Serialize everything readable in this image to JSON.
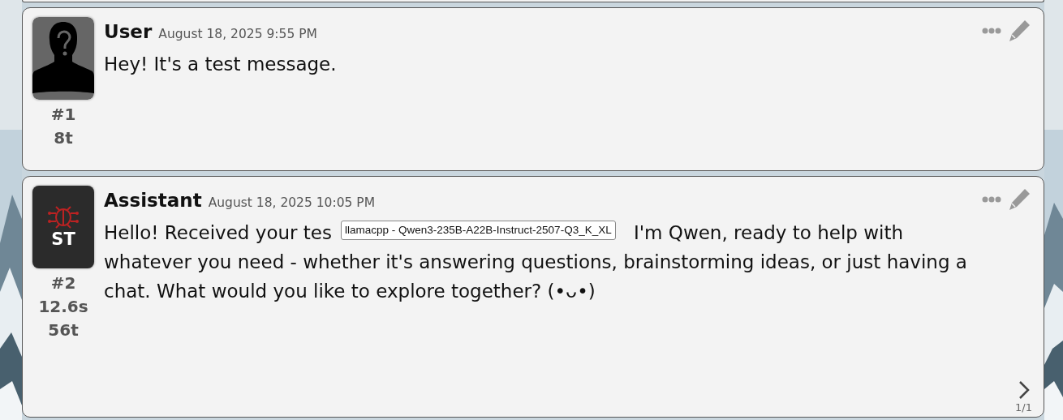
{
  "messages": [
    {
      "name": "User",
      "timestamp": "August 18, 2025 9:55 PM",
      "text": "Hey! It's a test message.",
      "avatar": {
        "kind": "user"
      },
      "index": "#1",
      "stats": [
        "8t"
      ]
    },
    {
      "name": "Assistant",
      "timestamp": "August 18, 2025 10:05 PM",
      "text_parts": [
        "Hello! Received your tes",
        "I'm Qwen, ready to help with",
        "whatever you need - whether it's answering questions, brainstorming ideas, or just having a chat. What would you like to explore together? (•ᴗ•)"
      ],
      "avatar": {
        "kind": "bot",
        "label": "ST"
      },
      "index": "#2",
      "stats": [
        "12.6s",
        "56t"
      ],
      "tooltip": "llamacpp - Qwen3-235B-A22B-Instruct-2507-Q3_K_XL",
      "swipe_counter": "1/1"
    }
  ]
}
